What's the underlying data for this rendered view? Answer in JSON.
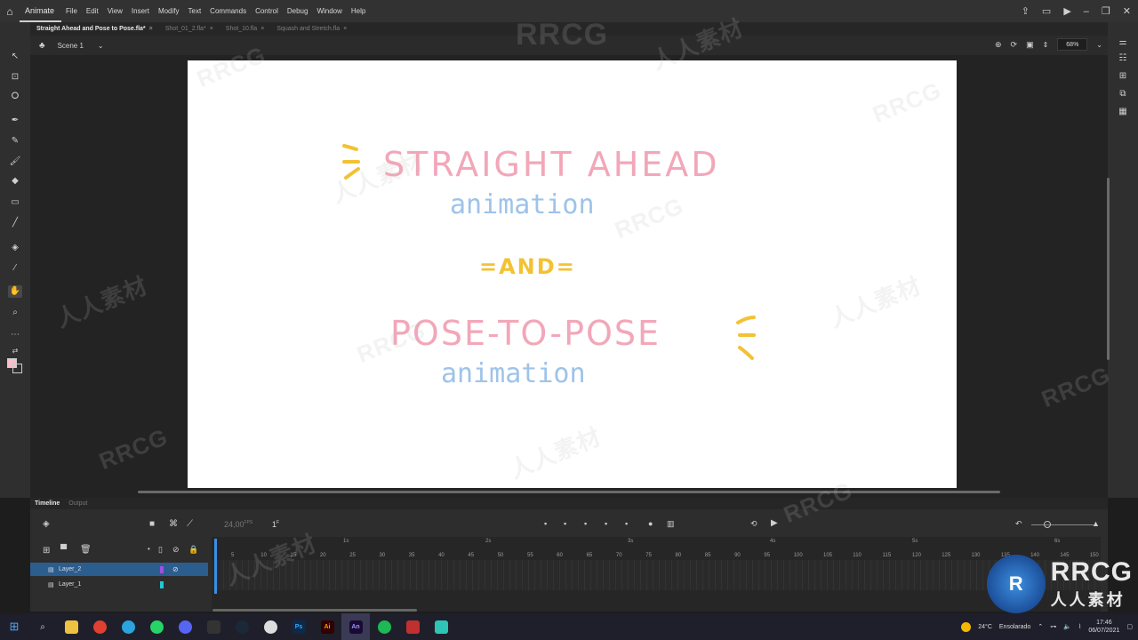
{
  "app": {
    "name": "Animate"
  },
  "menu": [
    "File",
    "Edit",
    "View",
    "Insert",
    "Modify",
    "Text",
    "Commands",
    "Control",
    "Debug",
    "Window",
    "Help"
  ],
  "tabs": [
    {
      "label": "Straight Ahead and Pose to Pose.fla*",
      "active": true
    },
    {
      "label": "Shot_01_2.fla*",
      "active": false
    },
    {
      "label": "Shot_10.fla",
      "active": false
    },
    {
      "label": "Squash and Stretch.fla",
      "active": false
    }
  ],
  "scene": {
    "name": "Scene 1",
    "zoom": "68%"
  },
  "canvas_text": {
    "line1": "STRAIGHT AHEAD",
    "line2": "animation",
    "line3": "=AND=",
    "line4": "POSE-TO-POSE",
    "line5": "animation"
  },
  "colors": {
    "pink": "#f2a7b9",
    "blue": "#9ec3ea",
    "yellow": "#f3c233",
    "accent_blue": "#2c5d8f",
    "playhead": "#3a8ee6"
  },
  "timeline": {
    "tab_timeline": "Timeline",
    "tab_output": "Output",
    "fps": "24,00",
    "fps_unit": "FPS",
    "frame": "1",
    "frame_unit": "F",
    "layers": [
      {
        "name": "Layer_2",
        "selected": true
      },
      {
        "name": "Layer_1",
        "selected": false
      }
    ],
    "ruler": [
      "5",
      "10",
      "15",
      "20",
      "25",
      "30",
      "35",
      "40",
      "45",
      "50",
      "55",
      "60",
      "65",
      "70",
      "75",
      "80",
      "85",
      "90",
      "95",
      "100",
      "105",
      "110",
      "115",
      "120",
      "125",
      "130",
      "135",
      "140",
      "145",
      "150"
    ],
    "seconds": [
      "1s",
      "2s",
      "3s",
      "4s",
      "5s",
      "6s"
    ]
  },
  "taskbar": {
    "weather": "24°C",
    "weather_desc": "Ensolarado",
    "time": "17:46",
    "date": "06/07/2021"
  },
  "watermark": {
    "text": "RRCG",
    "cn": "人人素材"
  }
}
